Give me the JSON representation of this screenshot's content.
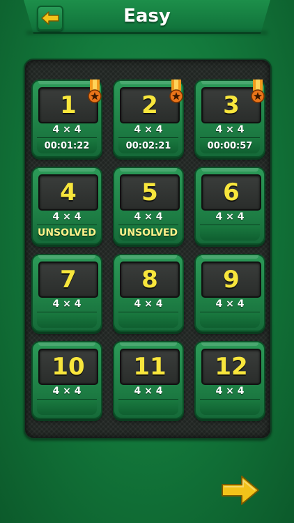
{
  "header": {
    "title": "Easy",
    "back_icon": "arrow-left-icon"
  },
  "colors": {
    "background": "#137a3c",
    "tile": "#1e7f45",
    "number": "#f8e63c",
    "unsolved": "#fbf28a",
    "arrow": "#f2c31a",
    "medal_ribbon": "#f29a1c",
    "medal": "#e9741a"
  },
  "levels": [
    {
      "number": "1",
      "size": "4 × 4",
      "status": "00:01:22",
      "medal": true
    },
    {
      "number": "2",
      "size": "4 × 4",
      "status": "00:02:21",
      "medal": true
    },
    {
      "number": "3",
      "size": "4 × 4",
      "status": "00:00:57",
      "medal": true
    },
    {
      "number": "4",
      "size": "4 × 4",
      "status": "UNSOLVED",
      "medal": false
    },
    {
      "number": "5",
      "size": "4 × 4",
      "status": "UNSOLVED",
      "medal": false
    },
    {
      "number": "6",
      "size": "4 × 4",
      "status": "",
      "medal": false
    },
    {
      "number": "7",
      "size": "4 × 4",
      "status": "",
      "medal": false
    },
    {
      "number": "8",
      "size": "4 × 4",
      "status": "",
      "medal": false
    },
    {
      "number": "9",
      "size": "4 × 4",
      "status": "",
      "medal": false
    },
    {
      "number": "10",
      "size": "4 × 4",
      "status": "",
      "medal": false
    },
    {
      "number": "11",
      "size": "4 × 4",
      "status": "",
      "medal": false
    },
    {
      "number": "12",
      "size": "4 × 4",
      "status": "",
      "medal": false
    }
  ],
  "footer": {
    "next_icon": "arrow-right-icon"
  }
}
